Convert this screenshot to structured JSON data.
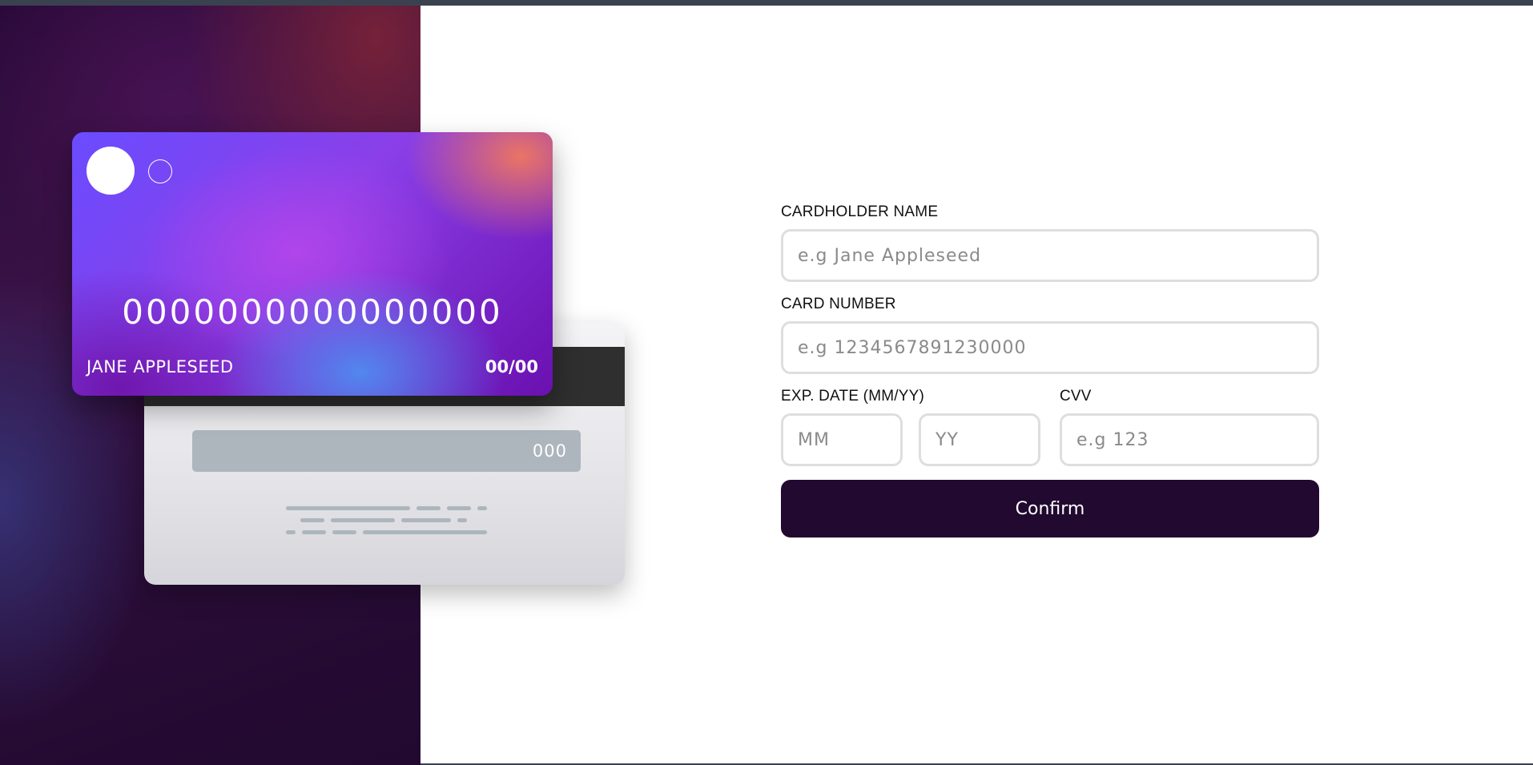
{
  "card_front": {
    "number": "0000000000000000",
    "holder": "JANE APPLESEED",
    "expiry": "00/00"
  },
  "card_back": {
    "cvv": "000"
  },
  "form": {
    "cardholder_label": "CARDHOLDER NAME",
    "cardholder_placeholder": "e.g Jane Appleseed",
    "number_label": "CARD NUMBER",
    "number_placeholder": "e.g 1234567891230000",
    "exp_label": "EXP. DATE (MM/YY)",
    "month_placeholder": "MM",
    "year_placeholder": "YY",
    "cvv_label": "CVV",
    "cvv_placeholder": "e.g 123",
    "confirm_label": "Confirm"
  },
  "colors": {
    "button_bg": "#21092f",
    "input_border": "#dedede",
    "cvv_strip": "#adb5bd"
  }
}
